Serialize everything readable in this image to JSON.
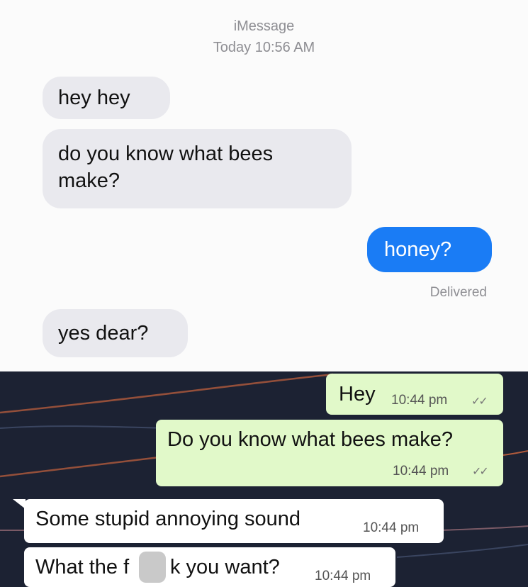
{
  "imessage": {
    "service": "iMessage",
    "timestamp": "Today 10:56 AM",
    "messages": [
      {
        "text": "hey hey",
        "direction": "incoming"
      },
      {
        "text": "do you know what bees make?",
        "direction": "incoming"
      },
      {
        "text": "honey?",
        "direction": "outgoing"
      },
      {
        "text": "yes dear?",
        "direction": "incoming"
      }
    ],
    "status": "Delivered"
  },
  "whatsapp": {
    "messages": [
      {
        "text": "Hey",
        "time": "10:44 pm",
        "direction": "outgoing",
        "ticks": "✓✓"
      },
      {
        "text": "Do you know what bees make?",
        "time": "10:44 pm",
        "direction": "outgoing",
        "ticks": "✓✓"
      },
      {
        "text": "Some stupid annoying sound",
        "time": "10:44 pm",
        "direction": "incoming"
      },
      {
        "text": "What the f",
        "text_after_blur": "k you want?",
        "time": "10:44 pm",
        "direction": "incoming"
      }
    ]
  },
  "colors": {
    "imessage_incoming": "#e9e9ee",
    "imessage_outgoing": "#1a7cf5",
    "whatsapp_outgoing": "#e1f9c9",
    "whatsapp_incoming": "#ffffff",
    "whatsapp_background": "#1c2233"
  }
}
